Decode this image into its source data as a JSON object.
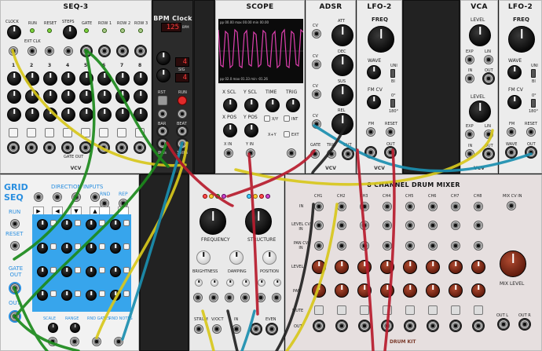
{
  "seq3": {
    "title": "SEQ-3",
    "labels": {
      "clock": "CLOCK",
      "run": "RUN",
      "reset": "RESET",
      "steps": "STEPS",
      "ext_clk": "EXT CLK",
      "gate": "GATE",
      "row1": "ROW 1",
      "row2": "ROW 2",
      "row3": "ROW 3",
      "gate_out": "GATE OUT"
    },
    "step_numbers": [
      "1",
      "2",
      "3",
      "4",
      "5",
      "6",
      "7",
      "8"
    ],
    "brand": "VCV"
  },
  "bpm_clock": {
    "title": "BPM Clock",
    "bpm_display": "125",
    "bpm_label": "BPM",
    "sig_value": "4",
    "sig_label": "SIG",
    "div_value": "4",
    "labels": {
      "rst": "RST",
      "run": "RUN",
      "bar": "BAR",
      "beat": "BEAT",
      "eighths": "8ths",
      "sixteenths": "16ths"
    }
  },
  "scope": {
    "title": "SCOPE",
    "readout_top": "pp 00.00  max 00.00  min 00.00",
    "readout_bottom": "pp 02.0  max 01.33  min -01.26",
    "labels": {
      "x_scl": "X SCL",
      "y_scl": "Y SCL",
      "time": "TIME",
      "trig": "TRIG",
      "x_pos": "X POS",
      "y_pos": "Y POS",
      "xy": "X/Y",
      "int": "INT",
      "xplusy": "X+Y",
      "ext": "EXT",
      "x_in": "X IN",
      "y_in": "Y IN",
      "trig_in": "TRIG"
    },
    "trace_color": "#e040b0"
  },
  "adsr": {
    "title": "ADSR",
    "labels": {
      "att": "ATT",
      "dec": "DEC",
      "sus": "SUS",
      "rel": "REL",
      "cv": "CV",
      "gate": "GATE",
      "trig": "TRIG",
      "out": "OUT"
    },
    "brand": "VCV"
  },
  "lfo2_a": {
    "title": "LFO-2",
    "labels": {
      "freq": "FREQ",
      "wave": "WAVE",
      "uni": "UNI",
      "bi": "BI",
      "fm_cv": "FM CV",
      "zero": "0°",
      "one_eighty": "180°",
      "fm": "FM",
      "reset": "RESET",
      "out": "OUT"
    },
    "brand": "VCV"
  },
  "vca": {
    "title": "VCA",
    "labels": {
      "level": "LEVEL",
      "exp": "EXP",
      "lin": "LIN",
      "in": "IN",
      "out": "OUT"
    },
    "brand": "VCV"
  },
  "lfo2_b": {
    "title": "LFO-2",
    "labels": {
      "freq": "FREQ",
      "wave": "WAVE",
      "uni": "UNI",
      "bi": "BI",
      "fm_cv": "FM CV",
      "zero": "0°",
      "one_eighty": "180°",
      "fm": "FM",
      "reset": "RESET",
      "wave_out": "WAVE",
      "out": "OUT"
    }
  },
  "gridseq": {
    "title_line1": "GRID",
    "title_line2": "SEQ",
    "direction_inputs": "DIRECTION INPUTS",
    "rnd": "RND",
    "rep": "REP",
    "run": "RUN",
    "reset": "RESET",
    "gate_out": "GATE OUT",
    "out": "OUT",
    "bottom_labels": [
      "SCALE",
      "RANGE",
      "RND GATES",
      "RND NOTES"
    ],
    "brand_color": "#2a8fe0"
  },
  "braids": {
    "labels": {
      "frequency": "FREQUENCY",
      "structure": "STRUCTURE",
      "brightness": "BRIGHTNESS",
      "damping": "DAMPING",
      "position": "POSITION",
      "strum": "STRUM",
      "v_oct": "V/OCT",
      "in": "IN",
      "out": "OUT",
      "even": "EVEN"
    }
  },
  "drum_mixer": {
    "title": "8 CHANNEL DRUM MIXER",
    "channels": [
      "CH1",
      "CH2",
      "CH3",
      "CH4",
      "CH5",
      "CH6",
      "CH7",
      "CH8"
    ],
    "mix_cv_in": "MIX CV IN",
    "row_labels": {
      "in": "IN",
      "level_cv": "LEVEL CV IN",
      "pan_cv": "PAN CV IN",
      "level": "LEVEL",
      "pan": "PAN",
      "mute": "MUTE",
      "out": "OUT"
    },
    "mix_level": "MIX LEVEL",
    "out_l": "OUT L",
    "out_r": "OUT R",
    "brand": "DRUM KIT"
  }
}
